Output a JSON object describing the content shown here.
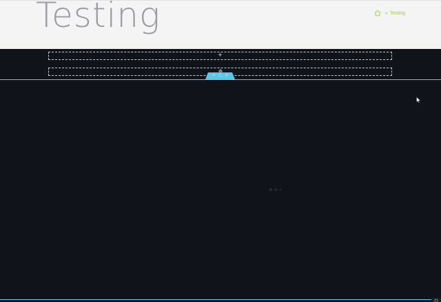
{
  "header": {
    "title": "Testing",
    "breadcrumb": {
      "home_icon": "home-icon",
      "separator": "»",
      "current": "Testing"
    }
  },
  "builder": {
    "dropzone_icon": "+",
    "drag_handle_icon": "✥",
    "section_toolbar": {
      "add_icon": "+",
      "handle_icon": ":::",
      "close_icon": "×"
    }
  },
  "colors": {
    "header_bg": "#f4f4f4",
    "page_bg": "#10141a",
    "accent_breadcrumb": "#a6c93a",
    "section_outline": "#5bc7e8",
    "title_text": "#9a9aa3"
  }
}
